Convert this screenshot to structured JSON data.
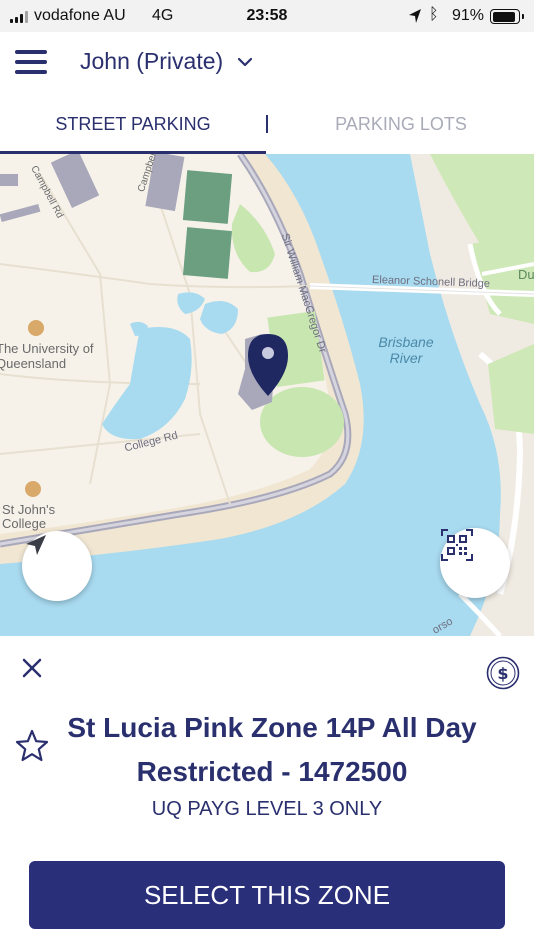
{
  "status_bar": {
    "carrier": "vodafone AU",
    "network": "4G",
    "time": "23:58",
    "battery_percent": "91%",
    "battery_level": 0.91,
    "icons": [
      "signal-icon",
      "location-arrow-icon",
      "bluetooth-icon",
      "battery-icon"
    ]
  },
  "header": {
    "account_name": "John (Private)"
  },
  "tabs": [
    {
      "label": "STREET PARKING",
      "active": true
    },
    {
      "label": "PARKING LOTS",
      "active": false
    }
  ],
  "map": {
    "labels": {
      "campbell_rd": "Campbell Rd",
      "campbell": "Campbell",
      "sir_william": "Sir William MacGregor Dr",
      "bridge": "Eleanor Schonell Bridge",
      "du": "Du",
      "university": "The University of Queensland",
      "college_rd": "College Rd",
      "st_johns": "St John's College",
      "orso": "orso"
    },
    "river": "Brisbane River"
  },
  "zone": {
    "title": "St Lucia Pink Zone 14P All Day Restricted - 1472500",
    "subtitle": "UQ PAYG LEVEL 3 ONLY",
    "select_label": "SELECT THIS ZONE"
  },
  "colors": {
    "brand": "#2a2f6e",
    "button": "#2a2f7a",
    "inactive_tab": "#a9abb8",
    "water": "#a8daf0",
    "land": "#f0e6d2",
    "park": "#c8e6b0",
    "parking_zone": "#a9a8ba"
  }
}
